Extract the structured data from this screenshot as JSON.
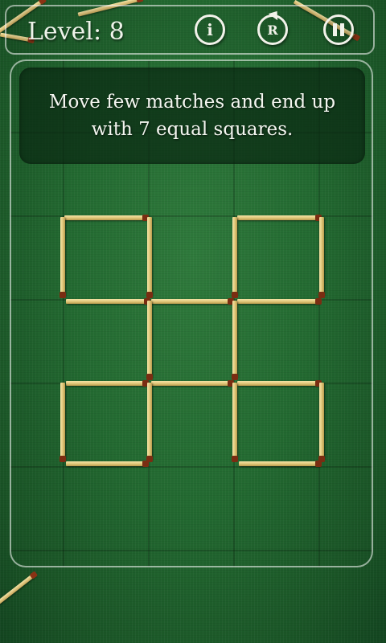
{
  "header": {
    "level_label": "Level: 8",
    "info_icon_glyph": "i",
    "restart_icon_glyph": "R"
  },
  "instruction": {
    "line1": "Move few matches and end up",
    "line2": "with 7 equal squares."
  },
  "icons": [
    "info-icon",
    "restart-icon",
    "pause-icon"
  ],
  "colors": {
    "felt": "#236a31",
    "match_stick": "#e2c97c",
    "match_head": "#7a2d12",
    "frame": "#ffffff"
  },
  "board": {
    "grid_rows": 3,
    "grid_cols": 3,
    "match_count": 22
  }
}
